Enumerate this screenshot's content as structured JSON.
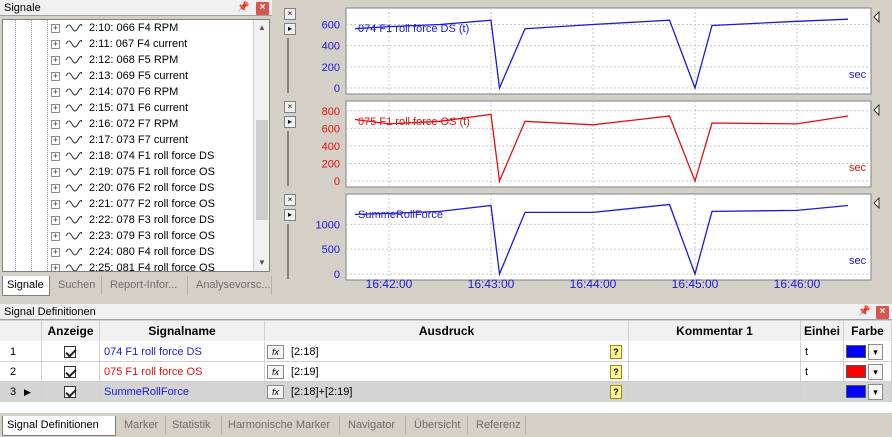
{
  "signals_panel": {
    "title": "Signale",
    "pin_icon": "pin-icon",
    "close_icon": "close-icon",
    "items": [
      {
        "label": "2:10: 066 F4 RPM"
      },
      {
        "label": "2:11: 067 F4 current"
      },
      {
        "label": "2:12: 068 F5 RPM"
      },
      {
        "label": "2:13: 069 F5 current"
      },
      {
        "label": "2:14: 070 F6 RPM"
      },
      {
        "label": "2:15: 071 F6 current"
      },
      {
        "label": "2:16: 072 F7 RPM"
      },
      {
        "label": "2:17: 073 F7 current"
      },
      {
        "label": "2:18: 074 F1 roll force DS"
      },
      {
        "label": "2:19: 075 F1 roll force OS"
      },
      {
        "label": "2:20: 076 F2 roll force DS"
      },
      {
        "label": "2:21: 077 F2 roll force OS"
      },
      {
        "label": "2:22: 078 F3 roll force DS"
      },
      {
        "label": "2:23: 079 F3 roll force OS"
      },
      {
        "label": "2:24: 080 F4 roll force DS"
      },
      {
        "label": "2:25: 081 F4 roll force OS"
      }
    ],
    "tabs": [
      "Signale",
      "Suchen",
      "Report-Infor...",
      "Analysevorsc..."
    ]
  },
  "charts": {
    "x_ticks": [
      "16:42:00",
      "16:43:00",
      "16:44:00",
      "16:45:00",
      "16:46:00"
    ],
    "unit": "sec",
    "colors": {
      "blue": "#1a1ad6",
      "red": "#e01010"
    },
    "plots": [
      {
        "legend": "074 F1 roll force DS (t)",
        "color": "#1a1ad6",
        "y_ticks": [
          "600",
          "400",
          "200",
          "0"
        ]
      },
      {
        "legend": "075 F1 roll force OS (t)",
        "color": "#e01010",
        "y_ticks": [
          "800",
          "600",
          "400",
          "200",
          "0"
        ]
      },
      {
        "legend": "SummeRollForce",
        "color": "#1a1ad6",
        "y_ticks": [
          "1000",
          "500",
          "0"
        ]
      }
    ]
  },
  "chart_data": [
    {
      "type": "line",
      "title": "074 F1 roll force DS (t)",
      "x": [
        "16:41:40",
        "16:42:00",
        "16:42:30",
        "16:43:00",
        "16:43:05",
        "16:43:20",
        "16:44:00",
        "16:44:45",
        "16:45:00",
        "16:45:10",
        "16:46:00",
        "16:46:30"
      ],
      "series": [
        {
          "name": "074 F1 roll force DS (t)",
          "values": [
            560,
            580,
            600,
            640,
            0,
            560,
            600,
            640,
            0,
            590,
            630,
            650
          ]
        }
      ],
      "ylim": [
        0,
        680
      ]
    },
    {
      "type": "line",
      "title": "075 F1 roll force OS (t)",
      "x": [
        "16:41:40",
        "16:42:00",
        "16:42:30",
        "16:43:00",
        "16:43:05",
        "16:43:20",
        "16:44:00",
        "16:44:45",
        "16:45:00",
        "16:45:10",
        "16:46:00",
        "16:46:30"
      ],
      "series": [
        {
          "name": "075 F1 roll force OS (t)",
          "values": [
            700,
            650,
            680,
            760,
            0,
            680,
            640,
            740,
            0,
            660,
            650,
            740
          ]
        }
      ],
      "ylim": [
        0,
        820
      ]
    },
    {
      "type": "line",
      "title": "SummeRollForce",
      "x": [
        "16:41:40",
        "16:42:00",
        "16:42:30",
        "16:43:00",
        "16:43:05",
        "16:43:20",
        "16:44:00",
        "16:44:45",
        "16:45:00",
        "16:45:10",
        "16:46:00",
        "16:46:30"
      ],
      "series": [
        {
          "name": "SummeRollForce",
          "values": [
            1200,
            1220,
            1260,
            1380,
            0,
            1240,
            1240,
            1400,
            0,
            1260,
            1280,
            1380
          ]
        }
      ],
      "ylim": [
        0,
        1450
      ]
    }
  ],
  "defs_panel": {
    "title": "Signal Definitionen",
    "pin_icon": "pin-icon",
    "close_icon": "close-icon",
    "headers": {
      "anzeige": "Anzeige",
      "signalname": "Signalname",
      "ausdruck": "Ausdruck",
      "kommentar": "Kommentar 1",
      "einheit": "Einhei",
      "farbe": "Farbe"
    },
    "rows": [
      {
        "num": "1",
        "name": "074 F1 roll force DS",
        "name_color": "#1a1ad6",
        "expr": "[2:18]",
        "unit": "t",
        "color": "#0000ff"
      },
      {
        "num": "2",
        "name": "075 F1 roll force OS",
        "name_color": "#e01010",
        "expr": "[2:19]",
        "unit": "t",
        "color": "#ff0000"
      },
      {
        "num": "3",
        "name": "SummeRollForce",
        "name_color": "#1a1ad6",
        "expr": "[2:18]+[2:19]",
        "unit": "",
        "color": "#0000ff"
      }
    ],
    "fx_label": "fx",
    "q_label": "?",
    "tabs": [
      "Signal Definitionen",
      "Marker",
      "Statistik",
      "Harmonische Marker",
      "Navigator",
      "Übersicht",
      "Referenz"
    ]
  }
}
